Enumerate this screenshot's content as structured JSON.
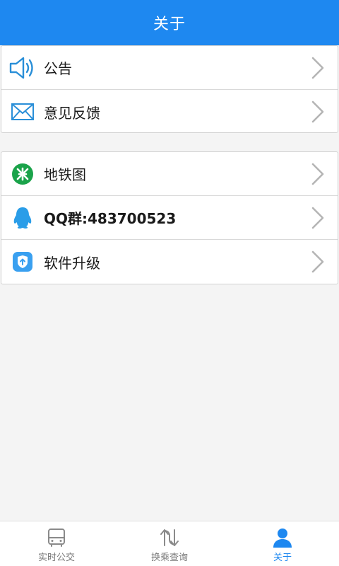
{
  "header": {
    "title": "关于"
  },
  "group1": [
    {
      "label": "公告",
      "icon": "speaker-icon"
    },
    {
      "label": "意见反馈",
      "icon": "mail-icon"
    }
  ],
  "group2": [
    {
      "label": "地铁图",
      "icon": "metro-logo-icon"
    },
    {
      "label": "QQ群:483700523",
      "icon": "qq-penguin-icon"
    },
    {
      "label": "软件升级",
      "icon": "upgrade-icon"
    }
  ],
  "nav": [
    {
      "label": "实时公交",
      "icon": "bus-icon",
      "active": false
    },
    {
      "label": "换乘查询",
      "icon": "transfer-arrows-icon",
      "active": false
    },
    {
      "label": "关于",
      "icon": "user-icon",
      "active": true
    }
  ],
  "colors": {
    "primary": "#1e88f0",
    "metro_green": "#1aa34a",
    "qq_blue": "#2a9de8"
  }
}
